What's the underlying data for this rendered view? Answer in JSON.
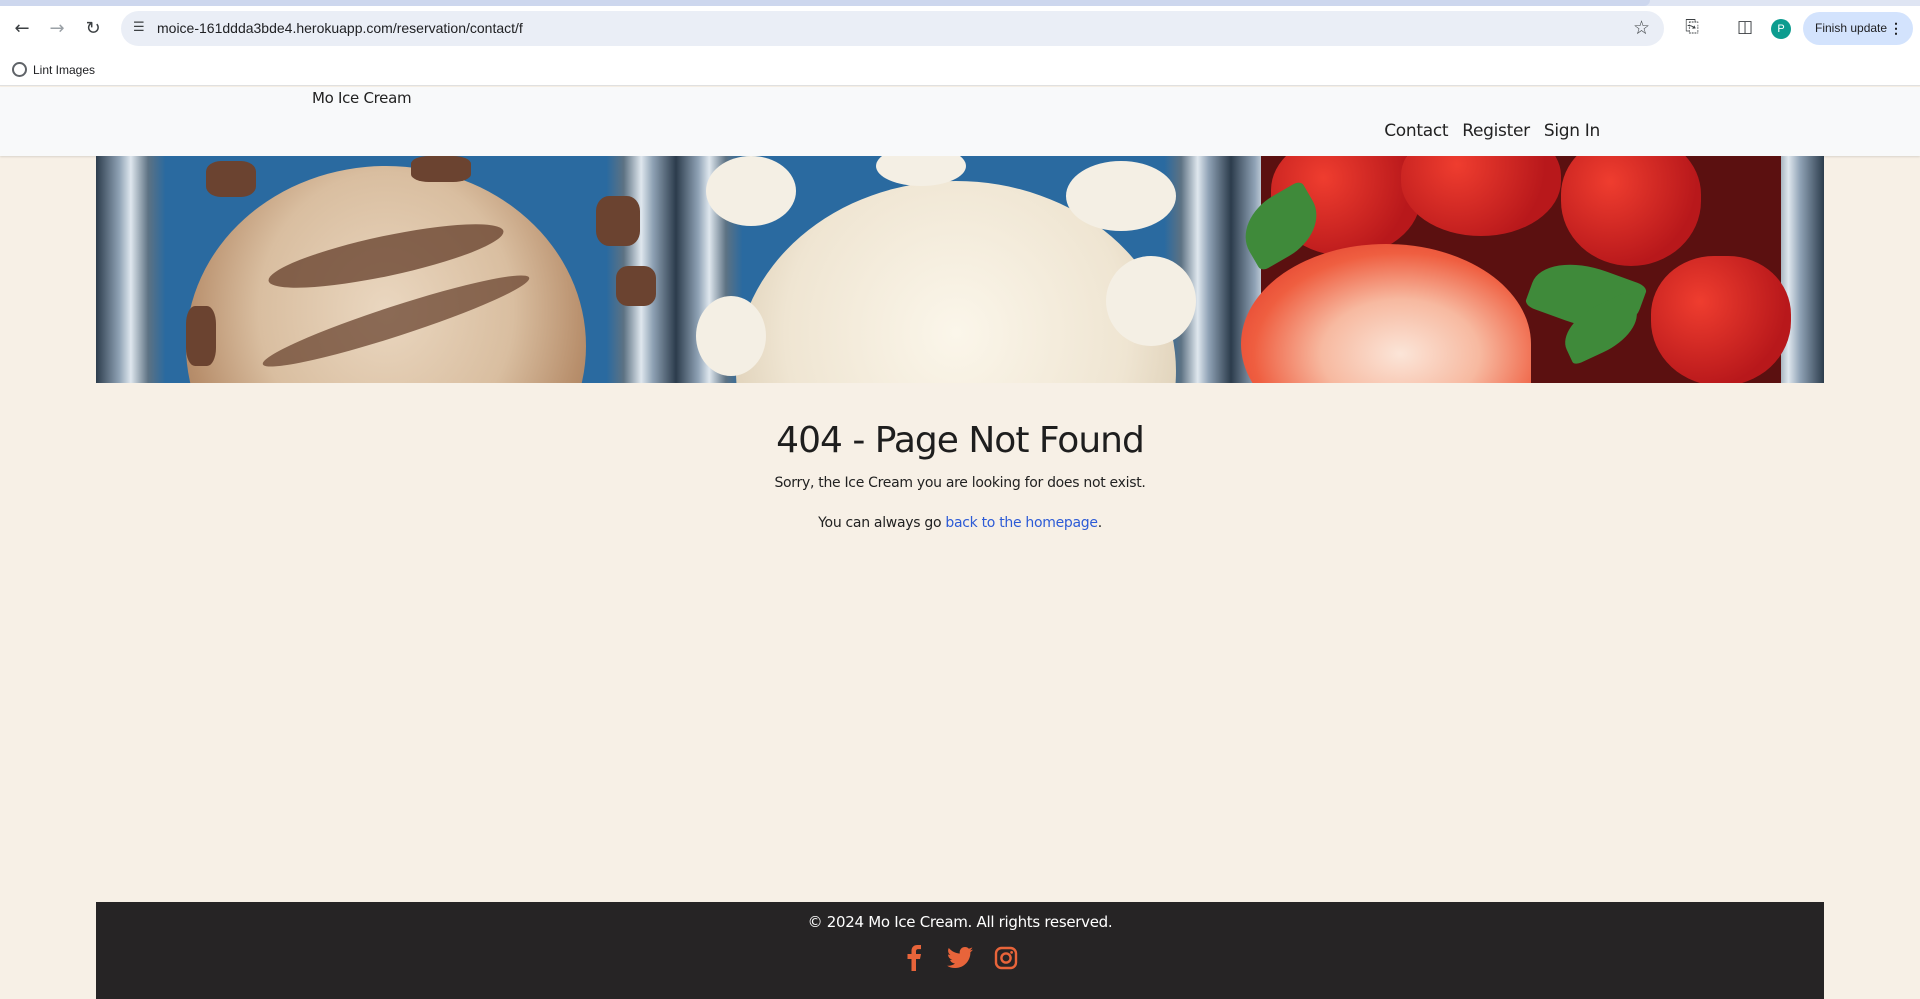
{
  "browser": {
    "url": "moice-161ddda3bde4.herokuapp.com/reservation/contact/f",
    "profile_initial": "P",
    "finish_update_label": "Finish update",
    "bookmarks": [
      {
        "label": "Lint Images"
      }
    ]
  },
  "site": {
    "brand": "Mo Ice Cream",
    "nav": [
      {
        "label": "Contact"
      },
      {
        "label": "Register"
      },
      {
        "label": "Sign In"
      }
    ]
  },
  "error": {
    "title": "404 - Page Not Found",
    "message": "Sorry, the Ice Cream you are looking for does not exist.",
    "link_prefix": "You can always go ",
    "link_text": "back to the homepage",
    "link_suffix": "."
  },
  "footer": {
    "copyright": "© 2024 Mo Ice Cream. All rights reserved.",
    "social_icons": [
      "facebook-icon",
      "twitter-icon",
      "instagram-icon"
    ],
    "icon_color": "#e8643a"
  },
  "colors": {
    "page_background": "#f7f0e6",
    "link": "#2d5bd6",
    "footer_background": "#262425"
  }
}
